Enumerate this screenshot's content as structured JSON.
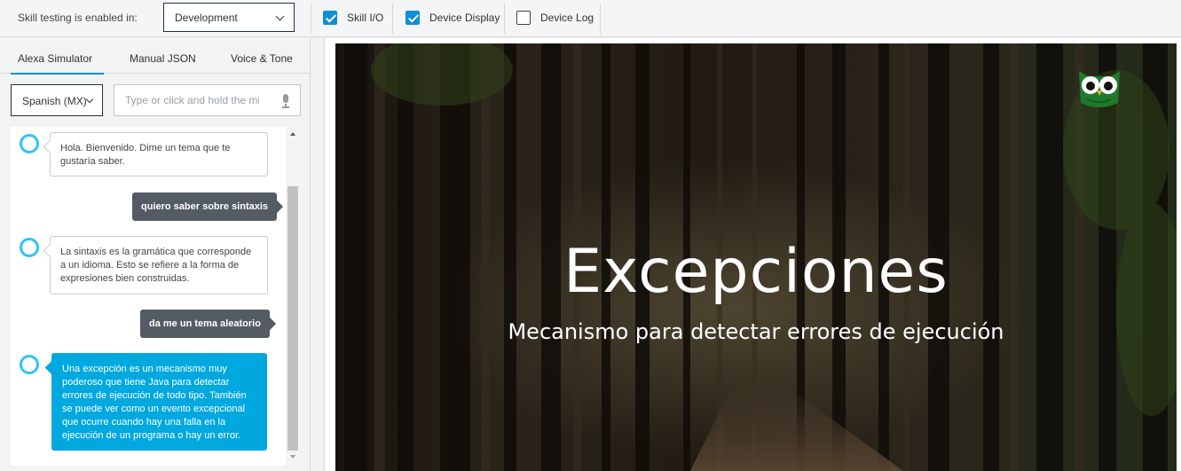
{
  "toolbar": {
    "env_label": "Skill testing is enabled in:",
    "env_value": "Development",
    "checkboxes": [
      {
        "label": "Skill I/O",
        "checked": true
      },
      {
        "label": "Device Display",
        "checked": true
      },
      {
        "label": "Device Log",
        "checked": false
      }
    ]
  },
  "tabs": [
    {
      "label": "Alexa Simulator",
      "active": true
    },
    {
      "label": "Manual JSON",
      "active": false
    },
    {
      "label": "Voice & Tone",
      "active": false
    }
  ],
  "language": "Spanish (MX)",
  "utterance": {
    "placeholder": "Type or click and hold the mic",
    "value": ""
  },
  "messages": [
    {
      "from": "alexa",
      "text": "Hola. Bienvenido. Dime un tema que te gustaría saber."
    },
    {
      "from": "user",
      "text": "quiero saber sobre sintaxis"
    },
    {
      "from": "alexa",
      "text": "La sintaxis es la gramática que corresponde a un idioma. Esto se refiere a la forma de expresiones bien construidas."
    },
    {
      "from": "user",
      "text": "da me un tema aleatorio"
    },
    {
      "from": "alexa",
      "text": "Una excepción es un mecanismo muy poderoso que tiene Java para detectar errores de ejecución de todo tipo. También se puede ver como un evento excepcional que ocurre cuando hay una falla en la ejecución de un programa o hay un error.",
      "highlighted": true
    }
  ],
  "display": {
    "title": "Excepciones",
    "subtitle": "Mecanismo para detectar errores de ejecución",
    "logo_icon": "owl-icon"
  },
  "colors": {
    "accent": "#0d8fd6",
    "alexa_ring": "#31c4f3",
    "highlight_bubble": "#00a8e0",
    "user_bubble": "#545b64"
  }
}
